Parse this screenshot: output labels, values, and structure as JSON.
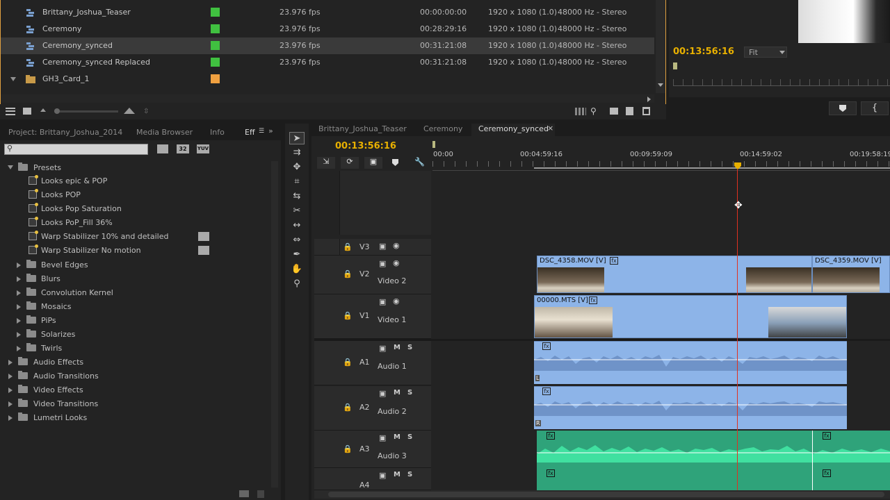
{
  "project_rows": [
    {
      "name": "Brittany_Joshua_Teaser",
      "fps": "23.976 fps",
      "duration": "00:00:00:00",
      "resolution": "1920 x 1080 (1.0)",
      "audio": "48000 Hz - Stereo",
      "label_color": "#40c040"
    },
    {
      "name": "Ceremony",
      "fps": "23.976 fps",
      "duration": "00:28:29:16",
      "resolution": "1920 x 1080 (1.0)",
      "audio": "48000 Hz - Stereo",
      "label_color": "#40c040"
    },
    {
      "name": "Ceremony_synced",
      "fps": "23.976 fps",
      "duration": "00:31:21:08",
      "resolution": "1920 x 1080 (1.0)",
      "audio": "48000 Hz - Stereo",
      "label_color": "#40c040"
    },
    {
      "name": "Ceremony_synced Replaced",
      "fps": "23.976 fps",
      "duration": "00:31:21:08",
      "resolution": "1920 x 1080 (1.0)",
      "audio": "48000 Hz - Stereo",
      "label_color": "#40c040"
    }
  ],
  "bin": {
    "name": "GH3_Card_1",
    "label_color": "#f0a040"
  },
  "monitor": {
    "timecode": "00:13:56:16",
    "fit": "Fit"
  },
  "effects_panel": {
    "tabs": [
      "Project: Brittany_Joshua_2014",
      "Media Browser",
      "Info",
      "Eff"
    ],
    "presets_label": "Presets",
    "preset_items": [
      "Looks epic & POP",
      "Looks POP",
      "Looks Pop Saturation",
      "Looks PoP_Fill 36%",
      "Warp Stabilizer 10% and detailed",
      "Warp Stabilizer No motion"
    ],
    "preset_folders": [
      "Bevel Edges",
      "Blurs",
      "Convolution Kernel",
      "Mosaics",
      "PiPs",
      "Solarizes",
      "Twirls"
    ],
    "categories": [
      "Audio Effects",
      "Audio Transitions",
      "Video Effects",
      "Video Transitions",
      "Lumetri Looks"
    ],
    "badges": [
      "32",
      "YUV"
    ]
  },
  "timeline": {
    "tabs": [
      "Brittany_Joshua_Teaser",
      "Ceremony",
      "Ceremony_synced"
    ],
    "timecode": "00:13:56:16",
    "ruler": [
      "00:00",
      "00:04:59:16",
      "00:09:59:09",
      "00:14:59:02",
      "00:19:58:19"
    ],
    "tracks": {
      "v3": {
        "id": "V3"
      },
      "v2": {
        "id": "V2",
        "name": "Video 2"
      },
      "v1": {
        "id": "V1",
        "name": "Video 1"
      },
      "a1": {
        "id": "A1",
        "name": "Audio 1"
      },
      "a2": {
        "id": "A2",
        "name": "Audio 2"
      },
      "a3": {
        "id": "A3",
        "name": "Audio 3"
      },
      "a4": {
        "id": "A4"
      }
    },
    "ms": {
      "m": "M",
      "s": "S"
    },
    "clips": {
      "v2a": "DSC_4358.MOV [V]",
      "v2b": "DSC_4359.MOV [V]",
      "v1": "00000.MTS [V]",
      "fx": "fx",
      "l": "L",
      "r": "R"
    }
  },
  "colors": {
    "accent": "#e8b000",
    "playhead": "#e03020",
    "clip_blue": "#8db4e8",
    "clip_green": "#2fa37a"
  }
}
